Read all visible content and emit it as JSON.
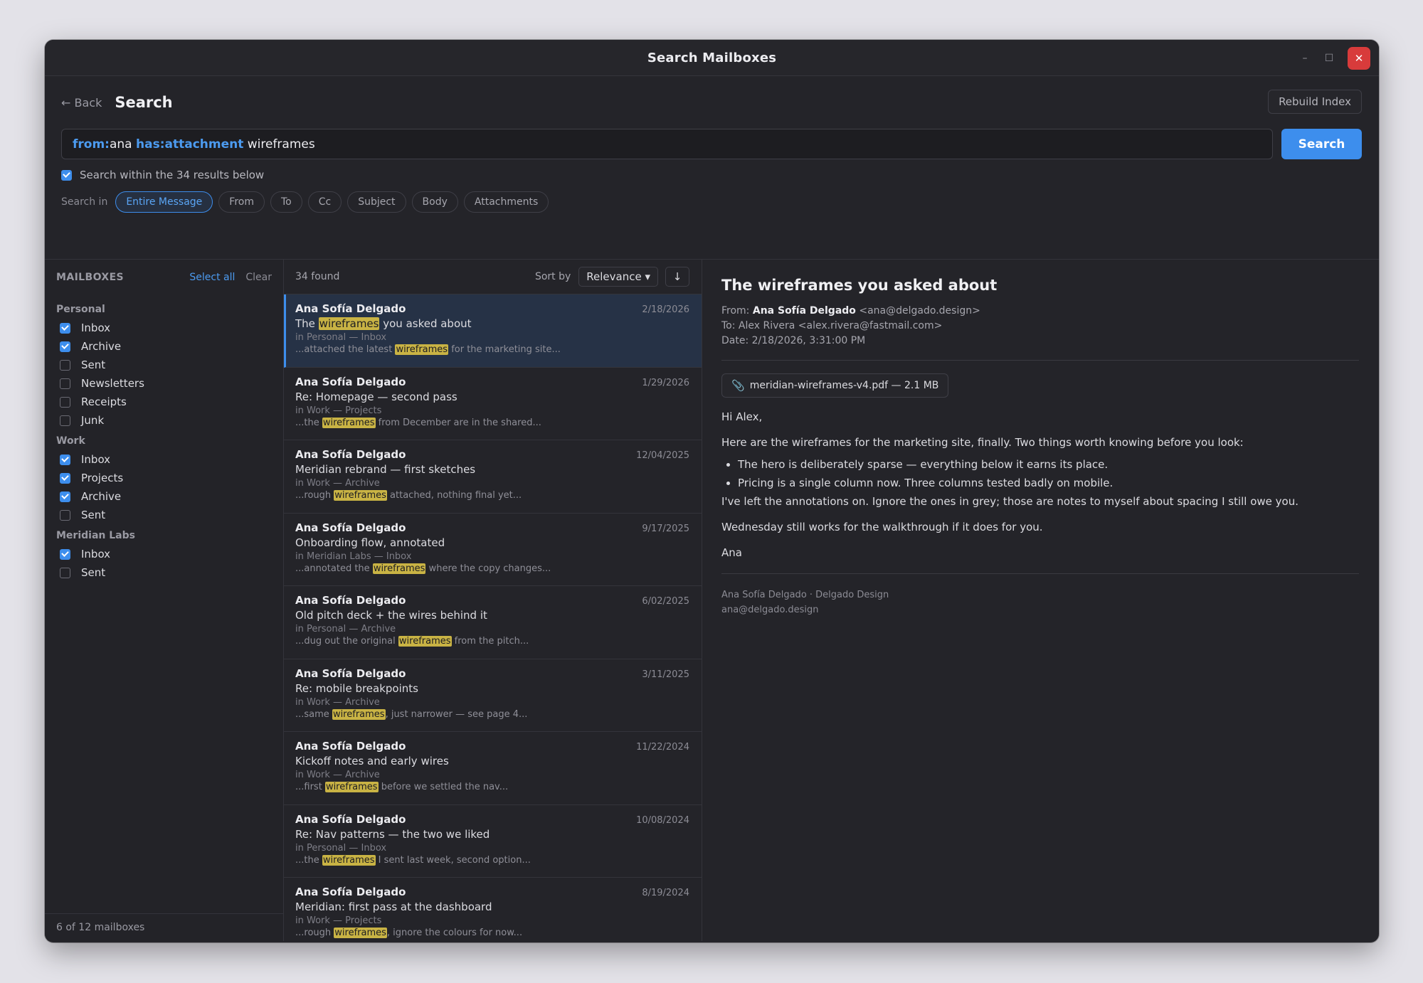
{
  "window": {
    "title": "Search Mailboxes"
  },
  "header": {
    "back_label": "← Back",
    "title": "Search",
    "rebuild_label": "Rebuild Index"
  },
  "search": {
    "tokens": [
      {
        "key": "from:",
        "value": "ana "
      },
      {
        "key": "has:attachment",
        "value": " wireframes"
      }
    ],
    "button_label": "Search",
    "within_label": "Search within the 34 results below",
    "within_checked": true,
    "scope_label": "Search in",
    "scopes": [
      "Entire Message",
      "From",
      "To",
      "Cc",
      "Subject",
      "Body",
      "Attachments"
    ],
    "active_scope": "Entire Message"
  },
  "sidebar": {
    "title": "MAILBOXES",
    "select_all": "Select all",
    "clear": "Clear",
    "groups": [
      {
        "name": "Personal",
        "mailboxes": [
          {
            "label": "Inbox",
            "checked": true
          },
          {
            "label": "Archive",
            "checked": true
          },
          {
            "label": "Sent",
            "checked": false
          },
          {
            "label": "Newsletters",
            "checked": false
          },
          {
            "label": "Receipts",
            "checked": false
          },
          {
            "label": "Junk",
            "checked": false
          }
        ]
      },
      {
        "name": "Work",
        "mailboxes": [
          {
            "label": "Inbox",
            "checked": true
          },
          {
            "label": "Projects",
            "checked": true
          },
          {
            "label": "Archive",
            "checked": true
          },
          {
            "label": "Sent",
            "checked": false
          }
        ]
      },
      {
        "name": "Meridian Labs",
        "mailboxes": [
          {
            "label": "Inbox",
            "checked": true
          },
          {
            "label": "Sent",
            "checked": false
          }
        ]
      }
    ],
    "footer": "6 of 12 mailboxes"
  },
  "results": {
    "count_label": "34 found",
    "sort_label": "Sort by",
    "sort_value": "Relevance ▾",
    "sort_dir": "↓",
    "items": [
      {
        "sender": "Ana Sofía Delgado",
        "date": "2/18/2026",
        "subject": [
          "The ",
          "wireframes",
          " you asked about"
        ],
        "location": "in Personal — Inbox",
        "snippet": [
          "...attached the latest ",
          "wireframes",
          " for the marketing site..."
        ],
        "selected": true
      },
      {
        "sender": "Ana Sofía Delgado",
        "date": "1/29/2026",
        "subject": [
          "Re: Homepage — second pass"
        ],
        "location": "in Work — Projects",
        "snippet": [
          "...the ",
          "wireframes",
          " from December are in the shared..."
        ]
      },
      {
        "sender": "Ana Sofía Delgado",
        "date": "12/04/2025",
        "subject": [
          "Meridian rebrand — first sketches"
        ],
        "location": "in Work — Archive",
        "snippet": [
          "...rough ",
          "wireframes",
          " attached, nothing final yet..."
        ]
      },
      {
        "sender": "Ana Sofía Delgado",
        "date": "9/17/2025",
        "subject": [
          "Onboarding flow, annotated"
        ],
        "location": "in Meridian Labs — Inbox",
        "snippet": [
          "...annotated the ",
          "wireframes",
          " where the copy changes..."
        ]
      },
      {
        "sender": "Ana Sofía Delgado",
        "date": "6/02/2025",
        "subject": [
          "Old pitch deck + the wires behind it"
        ],
        "location": "in Personal — Archive",
        "snippet": [
          "...dug out the original ",
          "wireframes",
          " from the pitch..."
        ]
      },
      {
        "sender": "Ana Sofía Delgado",
        "date": "3/11/2025",
        "subject": [
          "Re: mobile breakpoints"
        ],
        "location": "in Work — Archive",
        "snippet": [
          "...same ",
          "wireframes",
          ", just narrower — see page 4..."
        ]
      },
      {
        "sender": "Ana Sofía Delgado",
        "date": "11/22/2024",
        "subject": [
          "Kickoff notes and early wires"
        ],
        "location": "in Work — Archive",
        "snippet": [
          "...first ",
          "wireframes",
          " before we settled the nav..."
        ]
      },
      {
        "sender": "Ana Sofía Delgado",
        "date": "10/08/2024",
        "subject": [
          "Re: Nav patterns — the two we liked"
        ],
        "location": "in Personal — Inbox",
        "snippet": [
          "...the ",
          "wireframes",
          " I sent last week, second option..."
        ]
      },
      {
        "sender": "Ana Sofía Delgado",
        "date": "8/19/2024",
        "subject": [
          "Meridian: first pass at the dashboard"
        ],
        "location": "in Work — Projects",
        "snippet": [
          "...rough ",
          "wireframes",
          ", ignore the colours for now..."
        ]
      }
    ]
  },
  "preview": {
    "subject": "The wireframes you asked about",
    "from_label": "From:",
    "from_name": "Ana Sofía Delgado",
    "from_email": "<ana@delgado.design>",
    "to_line": "To: Alex Rivera <alex.rivera@fastmail.com>",
    "date_line": "Date: 2/18/2026, 3:31:00 PM",
    "attachment": "meridian-wireframes-v4.pdf — 2.1 MB",
    "greeting": "Hi Alex,",
    "intro": "Here are the wireframes for the marketing site, finally. Two things worth knowing before you look:",
    "bullets": [
      "The hero is deliberately sparse — everything below it earns its place.",
      "Pricing is a single column now. Three columns tested badly on mobile."
    ],
    "para2": "I've left the annotations on. Ignore the ones in grey; those are notes to myself about spacing I still owe you.",
    "para3": "Wednesday still works for the walkthrough if it does for you.",
    "signoff": "Ana",
    "sig_line1": "Ana Sofía Delgado · Delgado Design",
    "sig_line2": "ana@delgado.design"
  },
  "icons": {
    "minimize": "minimize-icon",
    "maximize": "maximize-icon",
    "close": "close-icon",
    "attachment": "paperclip-icon"
  },
  "colors": {
    "accent": "#3d8eed",
    "highlight": "#c9b344",
    "close": "#d83b3b"
  }
}
